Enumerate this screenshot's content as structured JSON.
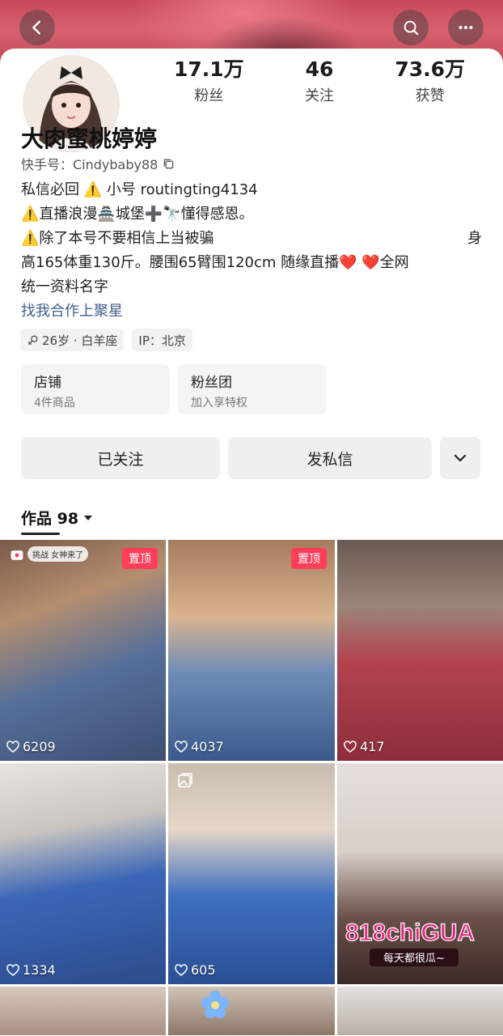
{
  "nav": {
    "back_icon": "back-arrow-icon",
    "search_icon": "search-icon",
    "more_icon": "more-dots-icon"
  },
  "profile": {
    "name": "大肉蜜桃婷婷",
    "kuaishou_id": "快手号：Cindybaby88",
    "stats": [
      {
        "value": "17.1万",
        "label": "粉丝"
      },
      {
        "value": "46",
        "label": "关注"
      },
      {
        "value": "73.6万",
        "label": "获赞"
      }
    ],
    "bio_lines": [
      "私信必回 ⚠️  小号 routingting4134",
      "⚠️直播浪漫🏯城堡➕🔭懂得感恩。",
      "⚠️除了本号不要相信上当被骗",
      "高165体重130斤。腰围65臂围120cm 随缘直播❤️       ❤️全网",
      "统一资料名字"
    ],
    "bio_line3_right": "身",
    "link": "找我合作上聚星",
    "tags": [
      {
        "icon": "gender-female-icon",
        "text": "26岁 · 白羊座"
      },
      {
        "icon": "",
        "text": "IP：北京"
      }
    ]
  },
  "shop_cards": [
    {
      "title": "店铺",
      "subtitle": "4件商品"
    },
    {
      "title": "粉丝团",
      "subtitle": "加入享特权"
    }
  ],
  "actions": {
    "follow": "已关注",
    "message": "发私信",
    "more_icon": "chevron-down-icon"
  },
  "works": {
    "label": "作品 98"
  },
  "grid": [
    {
      "likes": "6209",
      "pinned": "",
      "challenge": "挑战 女神来了"
    },
    {
      "likes": "4037",
      "pinned": "置顶"
    },
    {
      "likes": "417",
      "pinned": ""
    },
    {
      "likes": "1334",
      "pinned": ""
    },
    {
      "likes": "605",
      "pinned": "",
      "image_icon": "gallery-icon"
    },
    {
      "likes": "",
      "pinned": "",
      "ad_text": "818chiGUA",
      "ad_sub": "每天都很瓜~"
    }
  ],
  "pinned_label_1": "置顶",
  "colors": {
    "accent_red": "#ff3e5a",
    "link_blue": "#3f5e8c"
  }
}
